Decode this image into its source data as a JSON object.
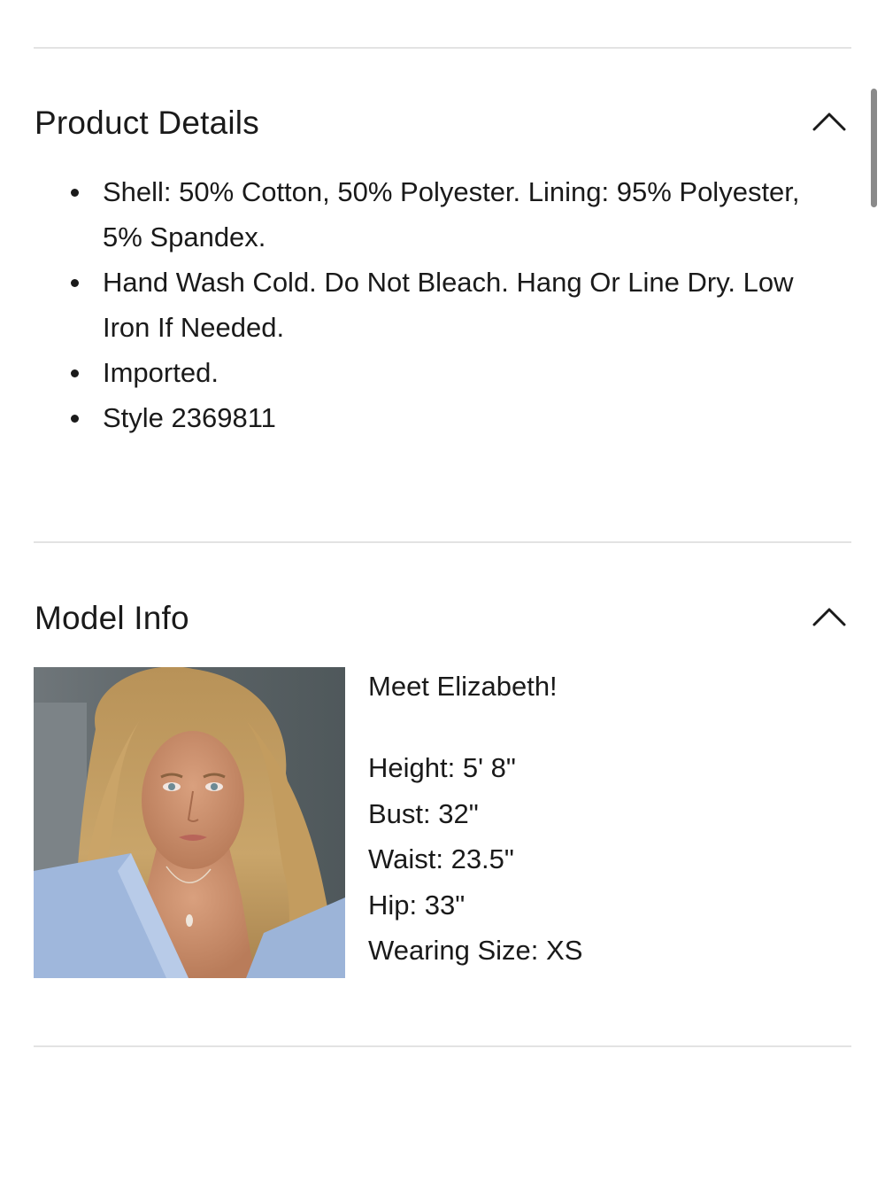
{
  "product_details": {
    "title": "Product Details",
    "toggle_icon": "chevron-up-icon",
    "items": [
      "Shell: 50% Cotton, 50% Polyester. Lining: 95% Polyester, 5% Spandex.",
      "Hand Wash Cold. Do Not Bleach. Hang Or Line Dry. Low Iron If Needed.",
      "Imported.",
      "Style 2369811"
    ]
  },
  "model_info": {
    "title": "Model Info",
    "toggle_icon": "chevron-up-icon",
    "intro": "Meet Elizabeth!",
    "stats": [
      "Height: 5' 8\"",
      "Bust: 32\"",
      "Waist: 23.5\"",
      "Hip: 33\"",
      "Wearing Size: XS"
    ]
  },
  "colors": {
    "text": "#1a1a1a",
    "divider": "#e3e3e3",
    "scrollbar": "#8a8a8a"
  }
}
